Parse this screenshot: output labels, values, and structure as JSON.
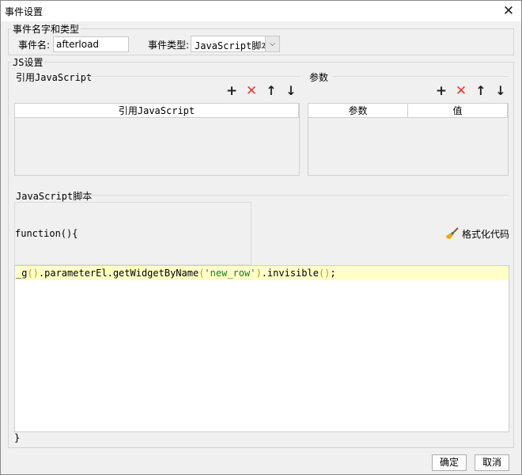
{
  "window": {
    "title": "事件设置",
    "close_glyph": "✕"
  },
  "event_group": {
    "legend": "事件名字和类型",
    "name_label": "事件名:",
    "name_value": "afterload",
    "type_label": "事件类型:",
    "type_value": "JavaScript脚本"
  },
  "js_group": {
    "legend": "JS设置",
    "ref_section": {
      "title": "引用JavaScript",
      "column": "引用JavaScript"
    },
    "param_section": {
      "title": "参数",
      "columns": [
        "参数",
        "值"
      ]
    },
    "toolbar_icons": [
      "plus-icon",
      "delete-icon",
      "arrow-up-icon",
      "arrow-down-icon"
    ],
    "script_section": {
      "title": "JavaScript脚本",
      "function_header": "function(){",
      "format_label": "格式化代码",
      "code": {
        "p1": "_g",
        "p2": "()",
        "p3": ".parameterEl.getWidgetByName",
        "p4": "(",
        "p5": "'new_row'",
        "p6": ")",
        "p7": ".invisible",
        "p8": "()",
        "p9": ";"
      },
      "function_footer": "}"
    }
  },
  "footer": {
    "ok": "确定",
    "cancel": "取消"
  },
  "colors": {
    "highlight": "#ffffc8",
    "delete": "#e53935",
    "string": "#1f7a1f"
  }
}
